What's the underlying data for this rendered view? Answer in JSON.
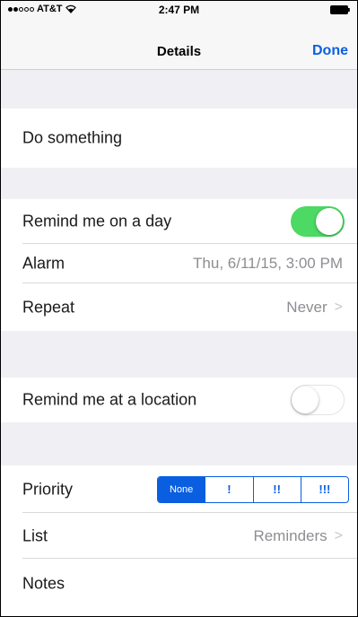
{
  "status_bar": {
    "carrier": "AT&T",
    "time": "2:47 PM",
    "signal_bars_on": 2,
    "signal_bars_total": 5
  },
  "nav": {
    "title": "Details",
    "done_label": "Done"
  },
  "title_row": {
    "text": "Do something"
  },
  "remind_day": {
    "label": "Remind me on a day",
    "toggle_on": true
  },
  "alarm": {
    "label": "Alarm",
    "value": "Thu, 6/11/15, 3:00 PM"
  },
  "repeat": {
    "label": "Repeat",
    "value": "Never",
    "chevron": ">"
  },
  "remind_location": {
    "label": "Remind me at a location",
    "toggle_on": false
  },
  "priority": {
    "label": "Priority",
    "options": [
      "None",
      "!",
      "!!",
      "!!!"
    ],
    "selected": "None"
  },
  "list": {
    "label": "List",
    "value": "Reminders",
    "chevron": ">"
  },
  "notes": {
    "label": "Notes"
  },
  "colors": {
    "accent_blue": "#0a5fe0",
    "toggle_green": "#4cd964",
    "group_background": "#efeff4",
    "secondary_text": "#8e8e93"
  }
}
